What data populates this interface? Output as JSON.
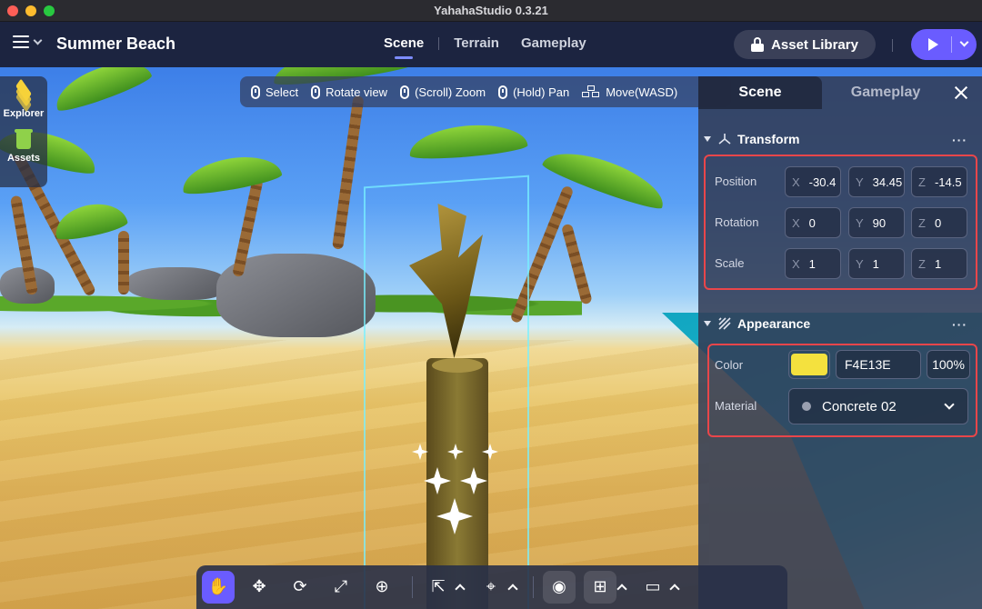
{
  "window": {
    "title": "YahahaStudio 0.3.21"
  },
  "header": {
    "project_title": "Summer Beach",
    "mode_tabs": [
      {
        "label": "Scene",
        "active": true
      },
      {
        "label": "Terrain",
        "active": false
      },
      {
        "label": "Gameplay",
        "active": false
      }
    ],
    "asset_library_label": "Asset Library"
  },
  "left_dock": {
    "items": [
      {
        "label": "Explorer",
        "icon": "layers-icon"
      },
      {
        "label": "Assets",
        "icon": "trash-icon"
      }
    ]
  },
  "hint_bar": {
    "items": [
      {
        "label": "Select",
        "icon": "mouse-left-icon"
      },
      {
        "label": "Rotate view",
        "icon": "mouse-right-icon"
      },
      {
        "label": "(Scroll) Zoom",
        "icon": "mouse-scroll-icon"
      },
      {
        "label": "(Hold) Pan",
        "icon": "mouse-middle-icon"
      },
      {
        "label": "Move(WASD)",
        "icon": "keys-icon"
      }
    ]
  },
  "panel": {
    "tabs": [
      {
        "label": "Scene",
        "active": true
      },
      {
        "label": "Gameplay",
        "active": false
      }
    ],
    "transform": {
      "title": "Transform",
      "more": "···",
      "rows": [
        {
          "label": "Position",
          "x": "-30.4",
          "y": "34.45",
          "z": "-14.5"
        },
        {
          "label": "Rotation",
          "x": "0",
          "y": "90",
          "z": "0"
        },
        {
          "label": "Scale",
          "x": "1",
          "y": "1",
          "z": "1"
        }
      ],
      "axis_labels": {
        "x": "X",
        "y": "Y",
        "z": "Z"
      }
    },
    "appearance": {
      "title": "Appearance",
      "more": "···",
      "color_label": "Color",
      "color_hex": "F4E13E",
      "color_swatch": "#f4e13e",
      "opacity": "100%",
      "material_label": "Material",
      "material_value": "Concrete 02"
    }
  },
  "colors": {
    "accent": "#6a5cff",
    "highlight_border": "#e9464a",
    "header_bg": "#1c2440"
  }
}
